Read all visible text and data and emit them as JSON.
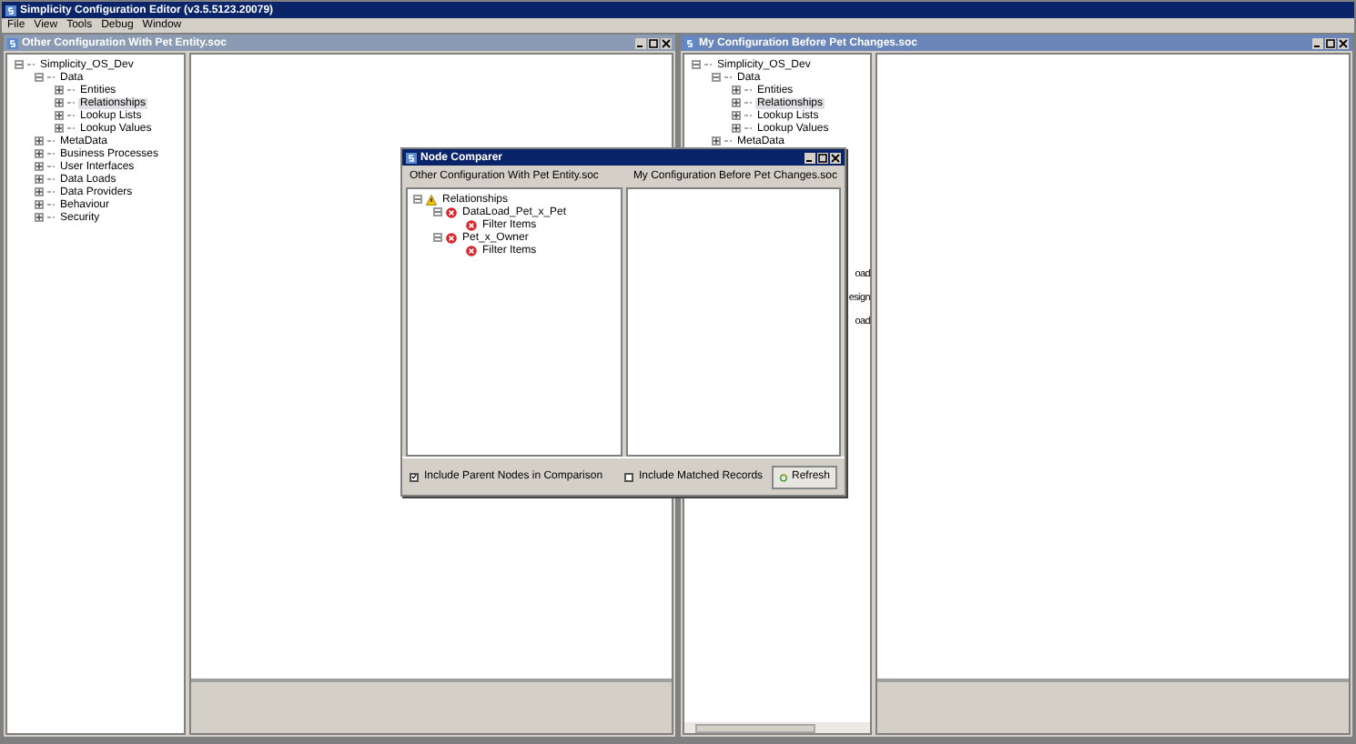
{
  "window": {
    "title": "Simplicity Configuration Editor (v3.5.5123.20079)"
  },
  "menu": [
    "File",
    "View",
    "Tools",
    "Debug",
    "Window"
  ],
  "child_windows": [
    {
      "title": "Other Configuration With Pet Entity.soc",
      "active": false,
      "tree": [
        {
          "label": "Simplicity_OS_Dev",
          "expanded": true,
          "selected": false,
          "children": [
            {
              "label": "Data",
              "expanded": true,
              "selected": false,
              "children": [
                {
                  "label": "Entities",
                  "expanded": false,
                  "selected": false
                },
                {
                  "label": "Relationships",
                  "expanded": false,
                  "selected": true
                },
                {
                  "label": "Lookup Lists",
                  "expanded": false,
                  "selected": false
                },
                {
                  "label": "Lookup Values",
                  "expanded": false,
                  "selected": false
                }
              ]
            },
            {
              "label": "MetaData",
              "expanded": false,
              "selected": false
            },
            {
              "label": "Business Processes",
              "expanded": false,
              "selected": false
            },
            {
              "label": "User Interfaces",
              "expanded": false,
              "selected": false
            },
            {
              "label": "Data Loads",
              "expanded": false,
              "selected": false
            },
            {
              "label": "Data Providers",
              "expanded": false,
              "selected": false
            },
            {
              "label": "Behaviour",
              "expanded": false,
              "selected": false
            },
            {
              "label": "Security",
              "expanded": false,
              "selected": false
            }
          ]
        }
      ]
    },
    {
      "title": "My Configuration Before Pet Changes.soc",
      "active": true,
      "tree": [
        {
          "label": "Simplicity_OS_Dev",
          "expanded": true,
          "selected": false,
          "children": [
            {
              "label": "Data",
              "expanded": true,
              "selected": false,
              "children": [
                {
                  "label": "Entities",
                  "expanded": false,
                  "selected": false
                },
                {
                  "label": "Relationships",
                  "expanded": false,
                  "selected": true
                },
                {
                  "label": "Lookup Lists",
                  "expanded": false,
                  "selected": false
                },
                {
                  "label": "Lookup Values",
                  "expanded": false,
                  "selected": false
                }
              ]
            },
            {
              "label": "MetaData",
              "expanded": false,
              "selected": false
            }
          ]
        }
      ],
      "partial_items": [
        "oad",
        "esign",
        "oad"
      ]
    }
  ],
  "dialog": {
    "title": "Node Comparer",
    "left_header": "Other Configuration With Pet Entity.soc",
    "right_header": "My Configuration Before Pet Changes.soc",
    "tree": [
      {
        "label": "Relationships",
        "kind": "warning",
        "expanded": true,
        "children": [
          {
            "label": "DataLoad_Pet_x_Pet",
            "kind": "error",
            "expanded": true,
            "children": [
              {
                "label": "Filter Items",
                "kind": "error"
              }
            ]
          },
          {
            "label": "Pet_x_Owner",
            "kind": "error",
            "expanded": true,
            "children": [
              {
                "label": "Filter Items",
                "kind": "error"
              }
            ]
          }
        ]
      }
    ],
    "options": [
      {
        "label": "Include Parent Nodes in Comparison",
        "checked": true
      },
      {
        "label": "Include Matched Records",
        "checked": false
      }
    ],
    "refresh_button": "Refresh"
  }
}
